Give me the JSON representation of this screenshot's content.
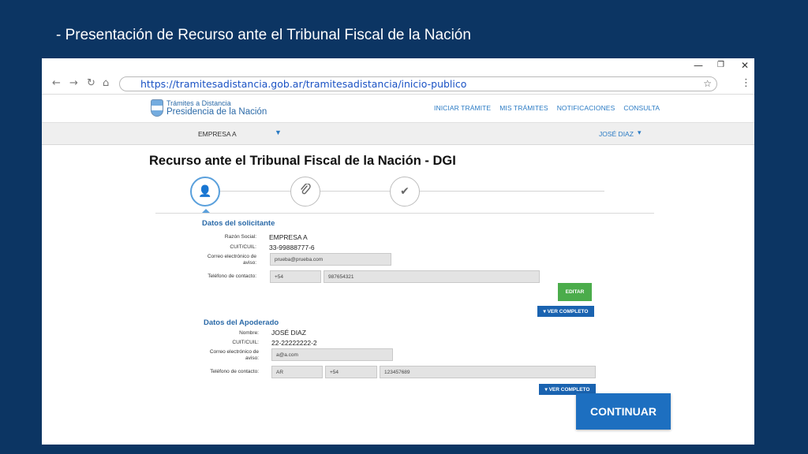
{
  "slide": {
    "title": "- Presentación de Recurso ante el Tribunal Fiscal de la Nación"
  },
  "browser": {
    "controls": {
      "minimize": "—",
      "maximize": "❐",
      "close": "✕"
    },
    "nav": {
      "back": "←",
      "forward": "→",
      "reload": "↻",
      "home": "⌂"
    },
    "url": "https://tramitesadistancia.gob.ar/tramitesadistancia/inicio-publico",
    "star_icon": "☆",
    "menu_icon": "⋮"
  },
  "site": {
    "logo_small": "Trámites a Distancia",
    "logo_big": "Presidencia de la Nación",
    "nav": [
      "INICIAR TRÁMITE",
      "MIS TRÁMITES",
      "NOTIFICACIONES",
      "CONSULTA"
    ],
    "company": "EMPRESA A",
    "company_caret": "▼",
    "user": "JOSÉ DIAZ",
    "user_caret": "▾"
  },
  "page": {
    "title": "Recurso ante el Tribunal Fiscal de la Nación - DGI",
    "steps": [
      {
        "icon": "user-icon",
        "glyph": "👤"
      },
      {
        "icon": "paperclip-icon",
        "glyph": "⌀"
      },
      {
        "icon": "check-icon",
        "glyph": "✔"
      }
    ]
  },
  "solicitante": {
    "title": "Datos del solicitante",
    "razon_social_label": "Razón Social:",
    "razon_social": "EMPRESA A",
    "cuit_label": "CUIT/CUIL:",
    "cuit": "33-99888777-6",
    "email_label": "Correo electrónico de aviso:",
    "email": "prueba@prueba.com",
    "telefono_label": "Teléfono de contacto:",
    "telefono_prefijo": "+54",
    "telefono_numero": "987654321",
    "edit_button": "EDITAR",
    "ver_completo": "▾ VER COMPLETO"
  },
  "apoderado": {
    "title": "Datos del Apoderado",
    "nombre_label": "Nombre:",
    "nombre": "JOSÉ DIAZ",
    "cuit_label": "CUIT/CUIL:",
    "cuit": "22-22222222-2",
    "email_label": "Correo electrónico de aviso:",
    "email": "a@a.com",
    "telefono_label": "Teléfono de contacto:",
    "telefono_pais": "AR",
    "telefono_prefijo": "+54",
    "telefono_numero": "123457689",
    "ver_completo": "▾ VER COMPLETO"
  },
  "continue_button": "CONTINUAR"
}
